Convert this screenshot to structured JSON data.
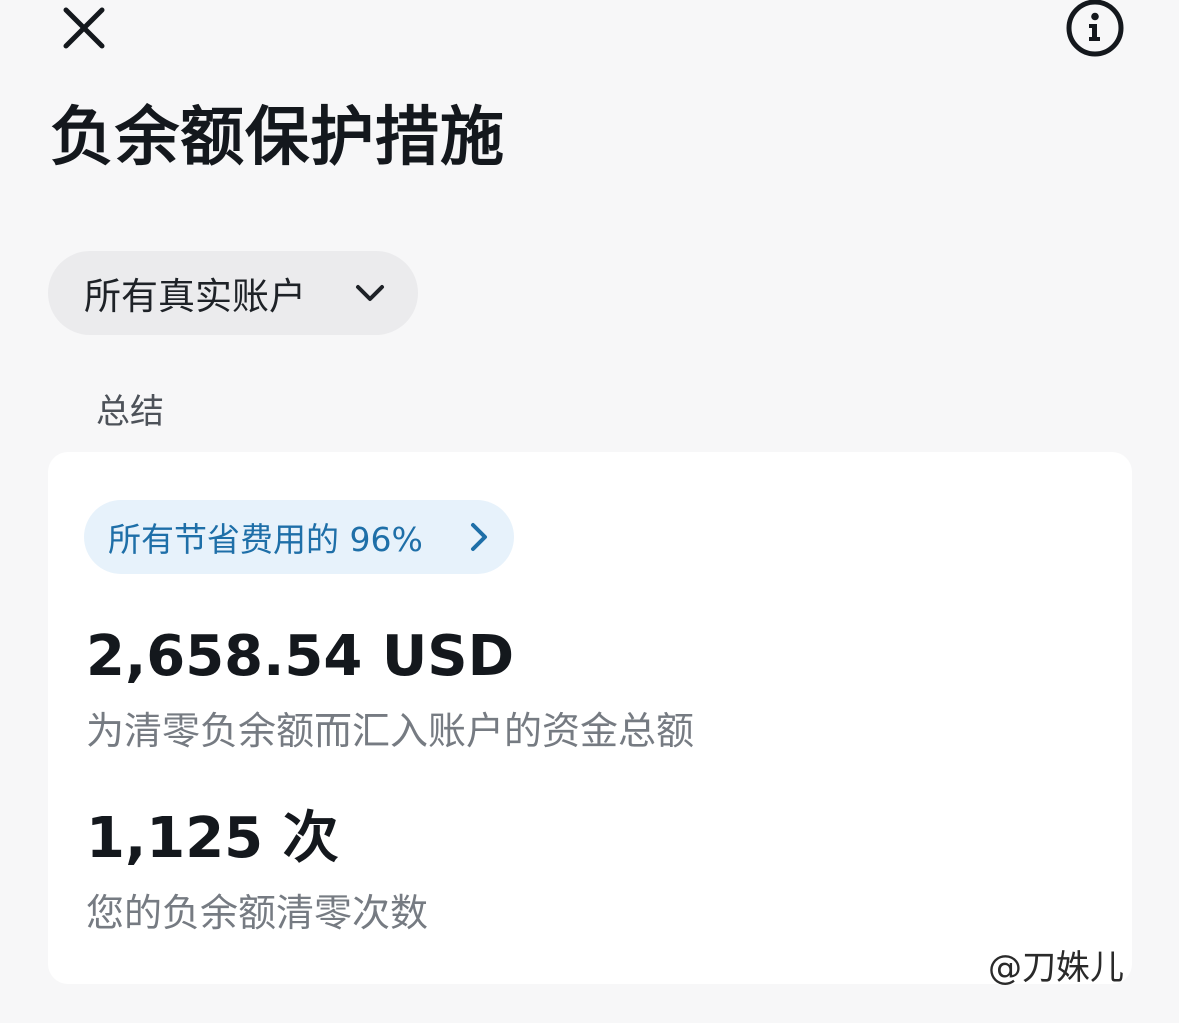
{
  "header": {
    "close_icon": "close-icon",
    "info_icon": "info-icon",
    "title": "负余额保护措施"
  },
  "account_filter": {
    "selected": "所有真实账户",
    "icon": "chevron-down-icon"
  },
  "section": {
    "label": "总结"
  },
  "summary": {
    "savings_pill": {
      "label": "所有节省费用的 96%",
      "icon": "chevron-right-icon",
      "color": "#1e6fa8"
    },
    "metrics": [
      {
        "value": "2,658.54 USD",
        "description": "为清零负余额而汇入账户的资金总额"
      },
      {
        "value": "1,125 次",
        "description": "您的负余额清零次数"
      }
    ]
  },
  "watermark": "@刀姝儿"
}
